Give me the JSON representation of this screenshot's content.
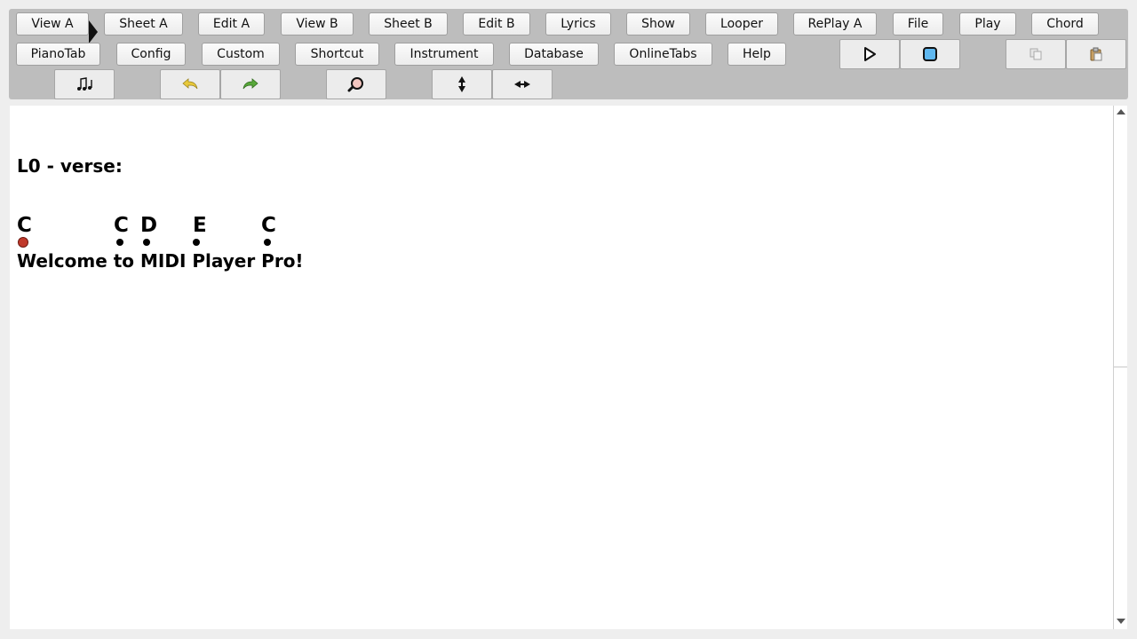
{
  "toolbar": {
    "row1": [
      "View A",
      "Sheet A",
      "Edit A",
      "View B",
      "Sheet B",
      "Edit B",
      "Lyrics",
      "Show",
      "Looper",
      "RePlay A",
      "File",
      "Play",
      "Chord"
    ],
    "row2": [
      "PianoTab",
      "Config",
      "Custom",
      "Shortcut",
      "Instrument",
      "Database",
      "OnlineTabs",
      "Help"
    ],
    "icons": [
      "play-icon",
      "stop-icon",
      "copy-icon",
      "paste-icon",
      "notes-icon",
      "undo-icon",
      "redo-icon",
      "search-zoom-icon",
      "vertical-resize-icon",
      "horizontal-resize-icon"
    ]
  },
  "colors": {
    "toolbar_bg": "#bdbdbd",
    "active_dot": "#c0392b",
    "stop_fill": "#5fb8f0",
    "undo": "#e8c93a",
    "redo": "#58a83a"
  },
  "content": {
    "section_title": "L0 - verse:",
    "chords": [
      "C",
      "C",
      "D",
      "E",
      "C"
    ],
    "lyric": "Welcome to MIDI Player Pro!"
  }
}
